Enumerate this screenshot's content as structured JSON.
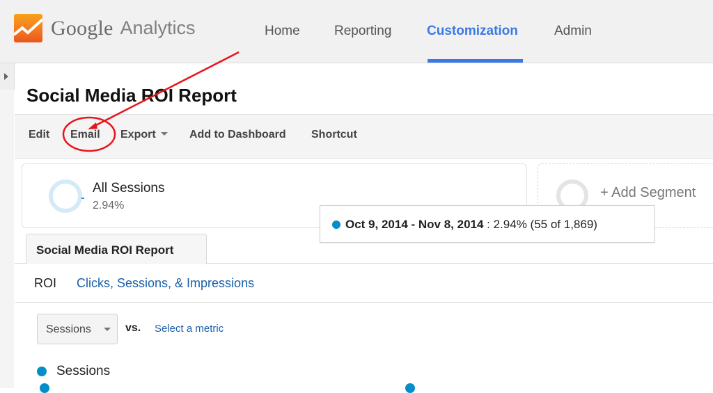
{
  "app": {
    "logo_primary": "Google",
    "logo_secondary": "Analytics"
  },
  "nav": {
    "items": [
      {
        "label": "Home",
        "active": false
      },
      {
        "label": "Reporting",
        "active": false
      },
      {
        "label": "Customization",
        "active": true
      },
      {
        "label": "Admin",
        "active": false
      }
    ],
    "accent_color": "#3b78e7"
  },
  "page": {
    "title": "Social Media ROI Report"
  },
  "toolbar": {
    "edit": "Edit",
    "email": "Email",
    "export": "Export",
    "add_to_dashboard": "Add to Dashboard",
    "shortcut": "Shortcut"
  },
  "segments": {
    "active": {
      "name": "All Sessions",
      "percent": "2.94%"
    },
    "add_label": "+ Add Segment"
  },
  "tooltip": {
    "date_range": "Oct 9, 2014 - Nov 8, 2014",
    "separator": " : ",
    "value": "2.94% (55 of 1,869)",
    "color": "#058dc7"
  },
  "report_tab": {
    "label": "Social Media ROI Report"
  },
  "subtabs": [
    {
      "label": "ROI",
      "current": true
    },
    {
      "label": "Clicks, Sessions, & Impressions",
      "current": false
    }
  ],
  "metric": {
    "selected": "Sessions",
    "vs_label": "vs.",
    "select_link": "Select a metric"
  },
  "chart_legend": {
    "series_label": "Sessions",
    "series_color": "#058dc7"
  },
  "annotation": {
    "color": "#e8141b",
    "target": "Email"
  }
}
